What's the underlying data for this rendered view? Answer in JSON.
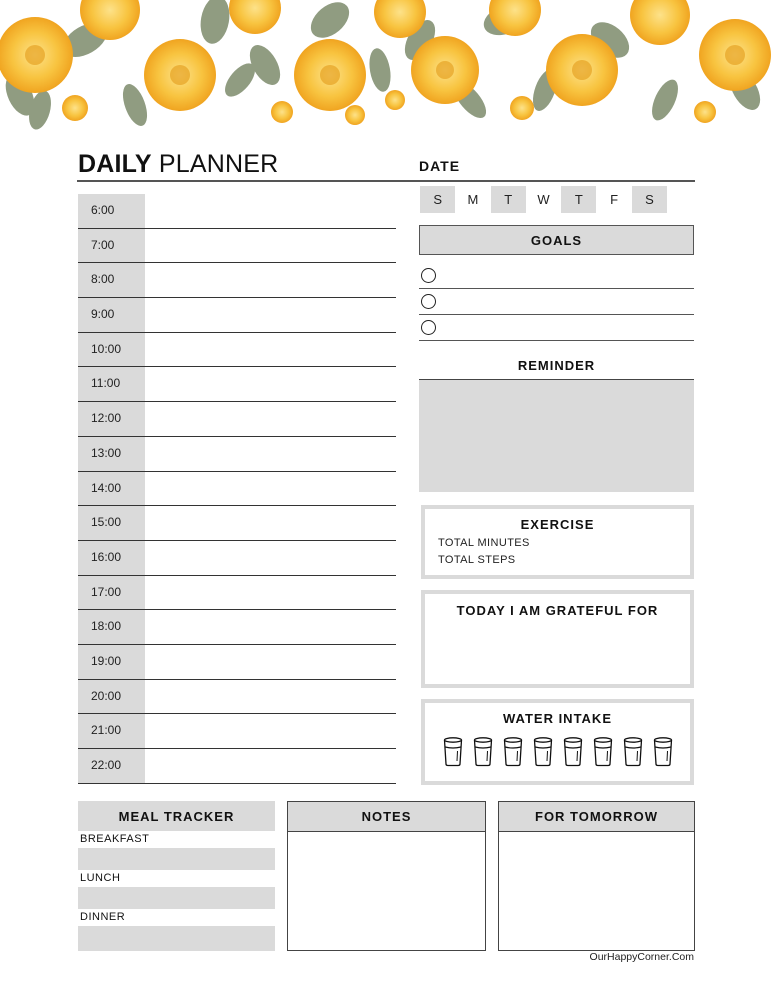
{
  "header": {
    "title_bold": "DAILY",
    "title_light": "PLANNER",
    "date_label": "DATE",
    "banner": "yellow-floral-banner"
  },
  "schedule": {
    "slots": [
      "6:00",
      "7:00",
      "8:00",
      "9:00",
      "10:00",
      "11:00",
      "12:00",
      "13:00",
      "14:00",
      "15:00",
      "16:00",
      "17:00",
      "18:00",
      "19:00",
      "20:00",
      "21:00",
      "22:00"
    ]
  },
  "days": [
    {
      "label": "S",
      "shaded": true
    },
    {
      "label": "M",
      "shaded": false
    },
    {
      "label": "T",
      "shaded": true
    },
    {
      "label": "W",
      "shaded": false
    },
    {
      "label": "T",
      "shaded": true
    },
    {
      "label": "F",
      "shaded": false
    },
    {
      "label": "S",
      "shaded": true
    }
  ],
  "goals": {
    "title": "GOALS",
    "count": 3
  },
  "reminder": {
    "title": "REMINDER"
  },
  "exercise": {
    "title": "EXERCISE",
    "lines": [
      "TOTAL MINUTES",
      "TOTAL STEPS"
    ]
  },
  "grateful": {
    "title": "TODAY I AM GRATEFUL FOR"
  },
  "water": {
    "title": "WATER INTAKE",
    "glasses": 8,
    "icon": "water-glass-icon"
  },
  "meal": {
    "title": "MEAL TRACKER",
    "rows": [
      "BREAKFAST",
      "LUNCH",
      "DINNER"
    ]
  },
  "notes": {
    "title": "NOTES"
  },
  "tomorrow": {
    "title": "FOR TOMORROW"
  },
  "footer": {
    "credit": "OurHappyCorner.Com"
  },
  "colors": {
    "shade": "#dadada",
    "line": "#444444",
    "flower": "#f6b52d"
  }
}
